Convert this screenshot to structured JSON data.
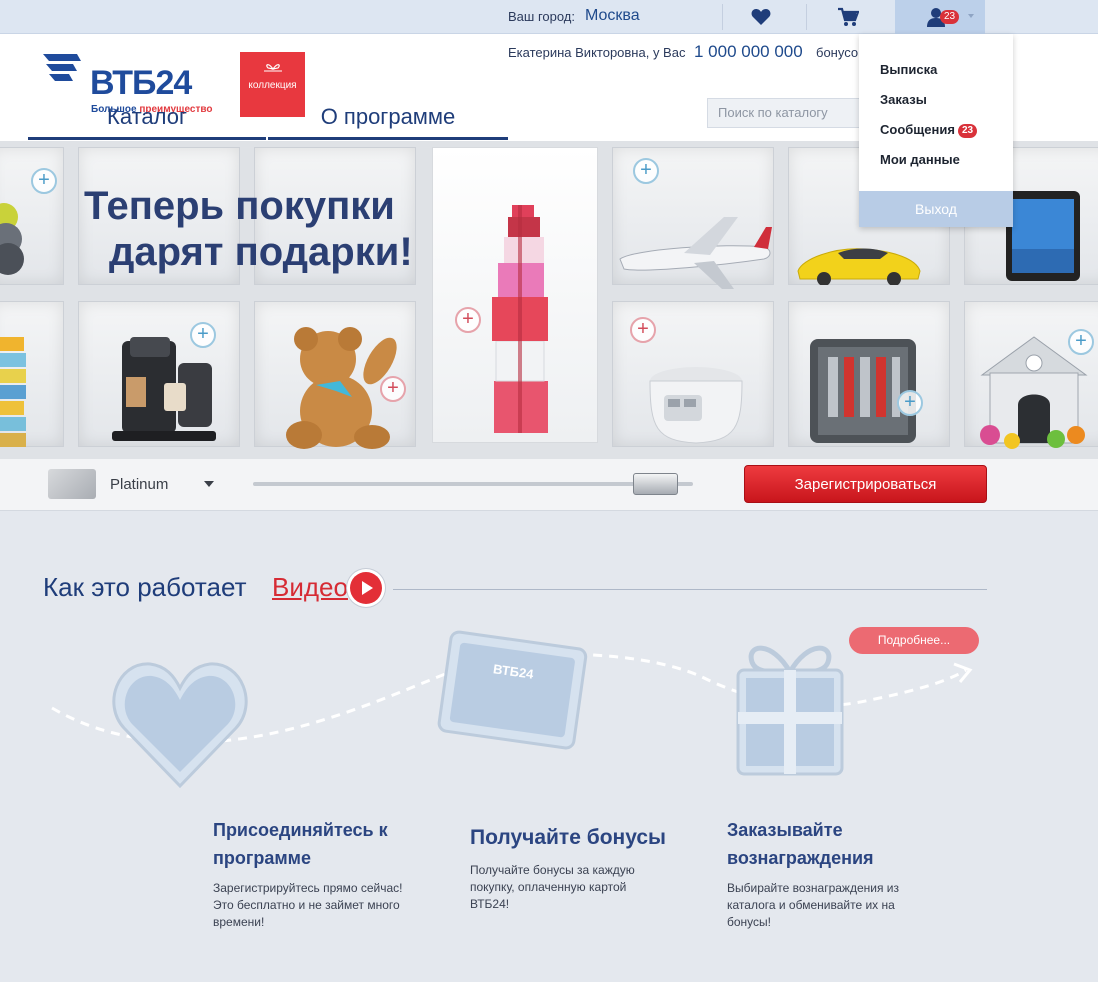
{
  "topbar": {
    "city_label": "Ваш город:",
    "city_value": "Москва",
    "user_badge": "23"
  },
  "header": {
    "logo_brand": "ВТБ24",
    "logo_slogan_part1": "Большое ",
    "logo_slogan_part2": "преимущество",
    "collection_label": "коллекция",
    "greeting": "Екатерина Викторовна, у Вас",
    "balance": "1 000 000 000",
    "balance_unit": "бонусов",
    "nav": [
      "Каталог",
      "О программе"
    ],
    "search_placeholder": "Поиск по каталогу"
  },
  "hero": {
    "title_line1": "Теперь покупки",
    "title_line2": "дарят подарки!"
  },
  "cardbar": {
    "card_name": "Platinum",
    "slider_value": 0.91,
    "register_label": "Зарегистрироваться"
  },
  "how": {
    "title": "Как это работает",
    "video_label": "Видео",
    "more_label": "Подробнее...",
    "card_logo": "ВТБ24",
    "steps": [
      {
        "title_line1": "Присоединяйтесь к",
        "title_line2": "программе",
        "text": [
          "Зарегистрируйтесь прямо сейчас!",
          "Это бесплатно и не займет много",
          "времени!"
        ]
      },
      {
        "title_line1": "Получайте бонусы",
        "title_line2": "",
        "text": [
          "Получайте бонусы за каждую",
          "покупку, оплаченную картой",
          "ВТБ24!"
        ]
      },
      {
        "title_line1": "Заказывайте",
        "title_line2": "вознаграждения",
        "text": [
          "Выбирайте вознаграждения из",
          "каталога и обменивайте их на",
          "бонусы!"
        ]
      }
    ]
  },
  "dropdown": {
    "items": [
      "Выписка",
      "Заказы",
      "Сообщения",
      "Мои данные"
    ],
    "messages_badge": "23",
    "exit_label": "Выход"
  },
  "colors": {
    "brand_blue": "#1f4b9c",
    "accent_red": "#e32f37",
    "exit_button": "#b8cce6"
  },
  "icons": [
    "favorites-heart-icon",
    "cart-icon",
    "user-icon",
    "play-icon",
    "plus-icon"
  ]
}
